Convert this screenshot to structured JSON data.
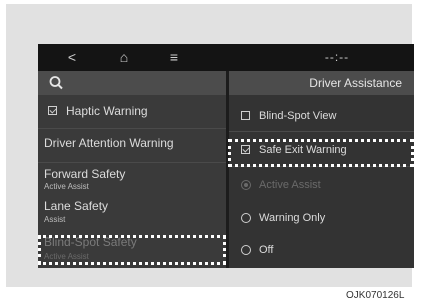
{
  "topbar": {
    "back_icon": "back-icon",
    "back_glyph": "<",
    "home_icon": "home-icon",
    "home_glyph": "⌂",
    "menu_icon": "menu-icon",
    "menu_glyph": "≡",
    "time": "--:--"
  },
  "left": {
    "search_icon": "search-icon",
    "items": [
      {
        "title": "Haptic Warning",
        "sub": ""
      },
      {
        "title": "Driver Attention Warning",
        "sub": ""
      },
      {
        "title": "Forward Safety",
        "sub": "Active Assist"
      },
      {
        "title": "Lane Safety",
        "sub": "Assist"
      },
      {
        "title": "Blind-Spot Safety",
        "sub": "Active Assist"
      }
    ]
  },
  "right": {
    "title": "Driver Assistance",
    "checkboxes": [
      {
        "label": "Blind-Spot View",
        "checked": false
      },
      {
        "label": "Safe Exit Warning",
        "checked": true
      }
    ],
    "radios": [
      {
        "label": "Active Assist",
        "selected": true,
        "disabled": true
      },
      {
        "label": "Warning Only",
        "selected": false,
        "disabled": false
      },
      {
        "label": "Off",
        "selected": false,
        "disabled": false
      }
    ]
  },
  "caption": "OJK070126L",
  "colors": {
    "screen_bg": "#2b2b2b",
    "topbar_bg": "#141414",
    "highlight_dash": "#ffffff"
  }
}
